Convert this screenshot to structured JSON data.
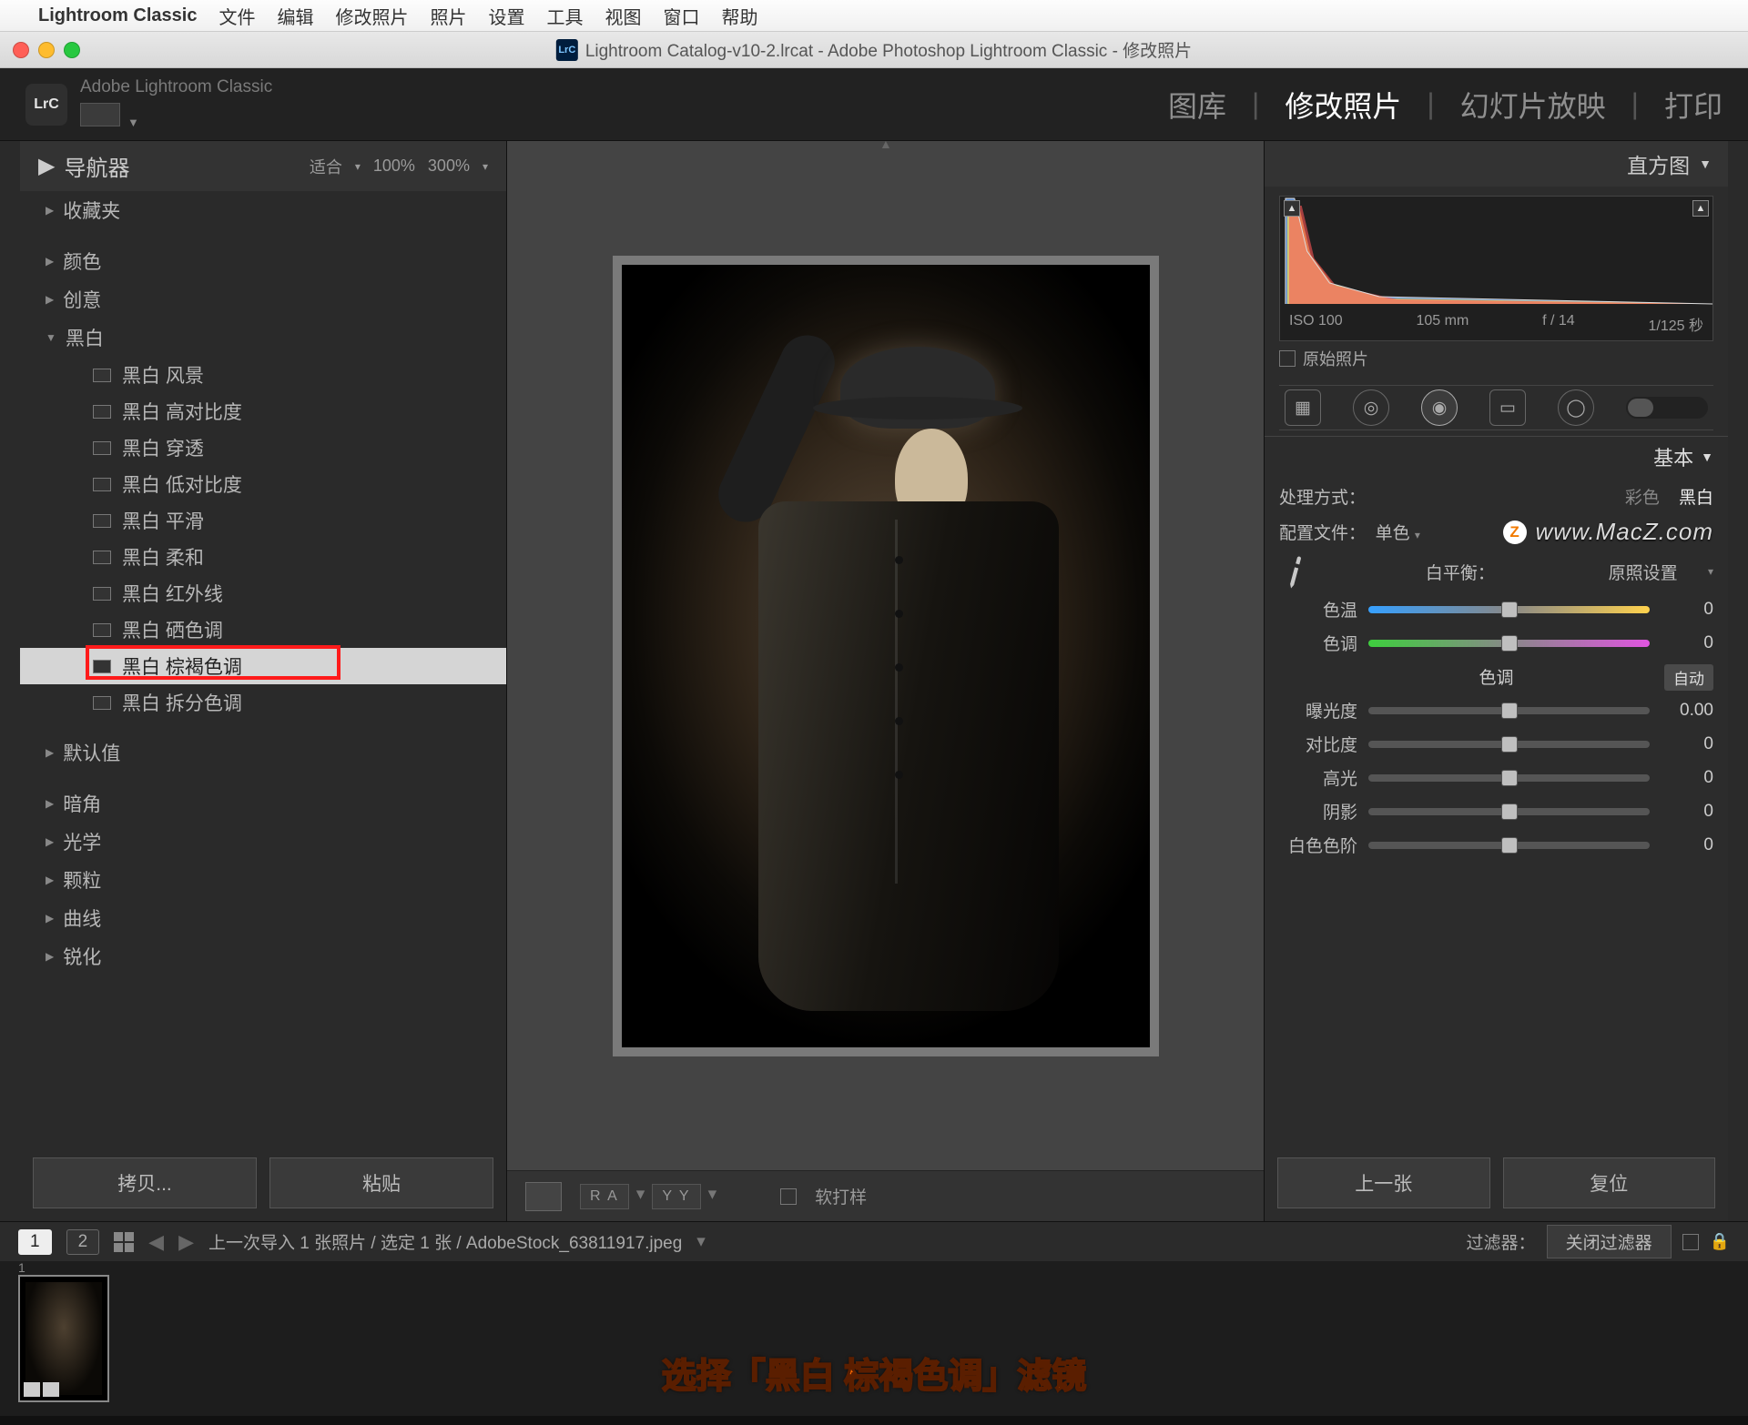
{
  "menubar": {
    "app": "Lightroom Classic",
    "items": [
      "文件",
      "编辑",
      "修改照片",
      "照片",
      "设置",
      "工具",
      "视图",
      "窗口",
      "帮助"
    ]
  },
  "window": {
    "title": "Lightroom Catalog-v10-2.lrcat - Adobe Photoshop Lightroom Classic - 修改照片"
  },
  "topbar": {
    "brand": "Adobe Lightroom Classic",
    "logo": "LrC",
    "modules": {
      "library": "图库",
      "develop": "修改照片",
      "slideshow": "幻灯片放映",
      "print": "打印"
    }
  },
  "left": {
    "navigator": "导航器",
    "zoom": {
      "fit": "适合",
      "p100": "100%",
      "p300": "300%"
    },
    "folders": {
      "favorites": "收藏夹",
      "color": "颜色",
      "creative": "创意",
      "bw": "黑白",
      "defaults": "默认值",
      "vignette": "暗角",
      "optics": "光学",
      "grain": "颗粒",
      "curves": "曲线",
      "sharpen": "锐化"
    },
    "bw_presets": [
      "黑白 风景",
      "黑白 高对比度",
      "黑白 穿透",
      "黑白 低对比度",
      "黑白 平滑",
      "黑白 柔和",
      "黑白 红外线",
      "黑白 硒色调",
      "黑白 棕褐色调",
      "黑白 拆分色调"
    ],
    "copy": "拷贝...",
    "paste": "粘贴"
  },
  "center": {
    "toolbar": {
      "ra": "R A",
      "yy": "Y Y",
      "softproof": "软打样"
    }
  },
  "right": {
    "histogram_title": "直方图",
    "histo_meta": {
      "iso": "ISO 100",
      "focal": "105 mm",
      "fstop": "f / 14",
      "shutter": "1/125 秒"
    },
    "original": "原始照片",
    "basic_title": "基本",
    "treatment_label": "处理方式：",
    "treatment": {
      "color": "彩色",
      "bw": "黑白"
    },
    "profile_label": "配置文件：",
    "profile_value": "单色",
    "watermark": "www.MacZ.com",
    "wb_label": "白平衡：",
    "wb_value": "原照设置",
    "sliders": {
      "temp": {
        "label": "色温",
        "value": "0",
        "pos": 50
      },
      "tint": {
        "label": "色调",
        "value": "0",
        "pos": 50
      },
      "section_tone": "色调",
      "auto": "自动",
      "exposure": {
        "label": "曝光度",
        "value": "0.00",
        "pos": 50
      },
      "contrast": {
        "label": "对比度",
        "value": "0",
        "pos": 50
      },
      "highlights": {
        "label": "高光",
        "value": "0",
        "pos": 50
      },
      "shadows": {
        "label": "阴影",
        "value": "0",
        "pos": 50
      },
      "whites": {
        "label": "白色色阶",
        "value": "0",
        "pos": 50
      }
    },
    "prev": "上一张",
    "reset": "复位"
  },
  "filterbar": {
    "one": "1",
    "two": "2",
    "breadcrumb": "上一次导入  1 张照片 /  选定 1 张 /  AdobeStock_63811917.jpeg",
    "filter_label": "过滤器：",
    "filter_value": "关闭过滤器"
  },
  "caption": "选择「黑白 棕褐色调」滤镜"
}
